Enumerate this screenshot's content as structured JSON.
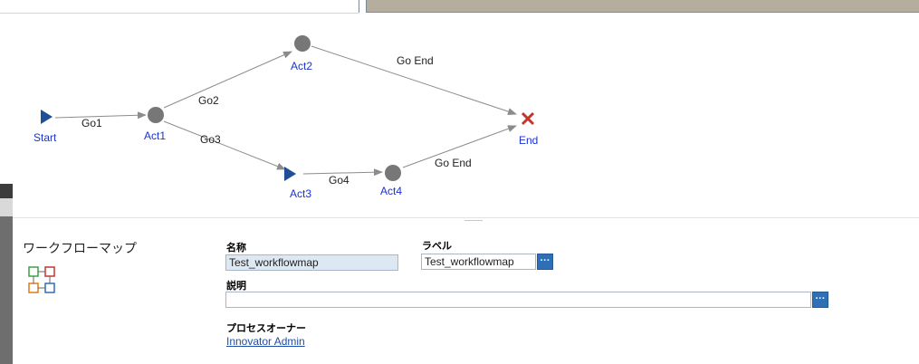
{
  "diagram": {
    "nodes": {
      "start": "Start",
      "act1": "Act1",
      "act2": "Act2",
      "act3": "Act3",
      "act4": "Act4",
      "end": "End"
    },
    "paths": {
      "go1": "Go1",
      "go2": "Go2",
      "go3": "Go3",
      "go4": "Go4",
      "go_end_top": "Go End",
      "go_end_bottom": "Go End"
    },
    "colors": {
      "activity": "#777777",
      "start_arrow": "#1f4f96",
      "end_cross": "#c0392b",
      "node_label": "#1a33cc",
      "edge": "#8c8c8c"
    }
  },
  "panel": {
    "title": "ワークフローマップ",
    "name_label": "名称",
    "name_value": "Test_workflowmap",
    "label_label": "ラベル",
    "label_value": "Test_workflowmap",
    "description_label": "説明",
    "description_value": "",
    "owner_label": "プロセスオーナー",
    "owner_value": "Innovator Admin",
    "ellipsis": "···"
  }
}
